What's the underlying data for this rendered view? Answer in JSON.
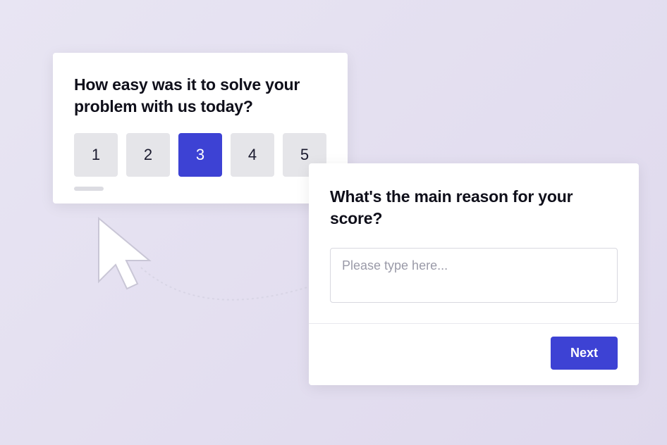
{
  "rating": {
    "question": "How easy was it to solve your problem with us today?",
    "options": [
      "1",
      "2",
      "3",
      "4",
      "5"
    ],
    "selected": "3"
  },
  "reason": {
    "question": "What's the main reason for your score?",
    "placeholder": "Please type here...",
    "next_label": "Next"
  },
  "colors": {
    "primary": "#3d42d4",
    "neutral_bg": "#e5e5e9"
  }
}
